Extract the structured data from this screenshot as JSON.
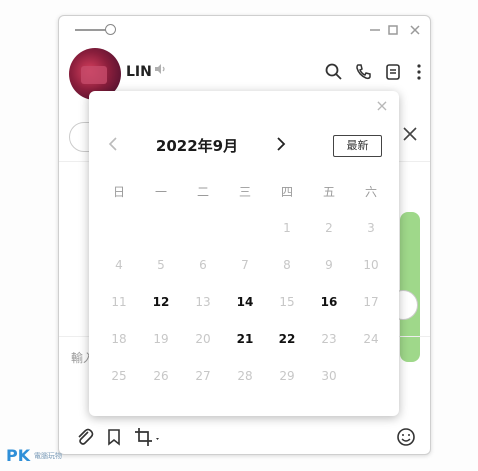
{
  "window": {
    "controls": [
      "minimize-icon",
      "maximize-icon",
      "close-icon"
    ]
  },
  "header": {
    "name": "LIN",
    "icons": [
      "speaker-icon",
      "search-icon",
      "phone-icon",
      "notes-icon",
      "more-icon"
    ]
  },
  "input": {
    "placeholder": "輸入"
  },
  "toolbar": {
    "icons": [
      "attach-icon",
      "bookmark-icon",
      "crop-icon",
      "emoji-icon"
    ]
  },
  "calendar": {
    "month_title": "2022年9月",
    "latest_label": "最新",
    "close_symbol": "×",
    "weekdays": [
      "日",
      "一",
      "二",
      "三",
      "四",
      "五",
      "六"
    ],
    "leading_blanks": 4,
    "days": [
      {
        "day": "1",
        "active": false
      },
      {
        "day": "2",
        "active": false
      },
      {
        "day": "3",
        "active": false
      },
      {
        "day": "4",
        "active": false
      },
      {
        "day": "5",
        "active": false
      },
      {
        "day": "6",
        "active": false
      },
      {
        "day": "7",
        "active": false
      },
      {
        "day": "8",
        "active": false
      },
      {
        "day": "9",
        "active": false
      },
      {
        "day": "10",
        "active": false
      },
      {
        "day": "11",
        "active": false
      },
      {
        "day": "12",
        "active": true
      },
      {
        "day": "13",
        "active": false
      },
      {
        "day": "14",
        "active": true
      },
      {
        "day": "15",
        "active": false
      },
      {
        "day": "16",
        "active": true
      },
      {
        "day": "17",
        "active": false
      },
      {
        "day": "18",
        "active": false
      },
      {
        "day": "19",
        "active": false
      },
      {
        "day": "20",
        "active": false
      },
      {
        "day": "21",
        "active": true
      },
      {
        "day": "22",
        "active": true
      },
      {
        "day": "23",
        "active": false
      },
      {
        "day": "24",
        "active": false
      },
      {
        "day": "25",
        "active": false
      },
      {
        "day": "26",
        "active": false
      },
      {
        "day": "27",
        "active": false
      },
      {
        "day": "28",
        "active": false
      },
      {
        "day": "29",
        "active": false
      },
      {
        "day": "30",
        "active": false
      }
    ]
  },
  "watermark": {
    "logo": "PK",
    "sub": "電腦玩物"
  },
  "colors": {
    "bubble_green": "#9fd88a",
    "active_day": "#111111",
    "inactive_day": "#c7c7c7"
  }
}
